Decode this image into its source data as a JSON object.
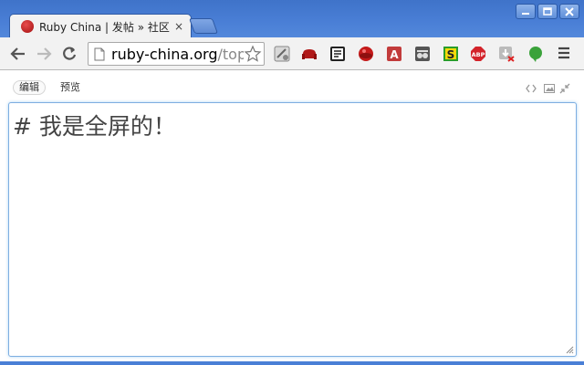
{
  "window": {
    "controls": [
      "minimize",
      "maximize",
      "close"
    ]
  },
  "tab": {
    "title": "Ruby China | 发帖 » 社区",
    "close_glyph": "×",
    "favicon": "ruby-china-favicon"
  },
  "toolbar": {
    "back_icon": "back-arrow-icon",
    "forward_icon": "forward-arrow-icon",
    "reload_icon": "reload-icon",
    "url_host": "ruby-china.org",
    "url_rest": "/top",
    "extensions": [
      "image-edit-extension-icon",
      "sofa-extension-icon",
      "note-extension-icon",
      "ruby-extension-icon",
      "a-extension-icon",
      "glasses-extension-icon",
      "s-extension-icon",
      "adblock-plus-extension-icon",
      "download-x-extension-icon",
      "evernote-extension-icon"
    ],
    "abp_text": "ABP",
    "a_text": "A",
    "s_text": "S"
  },
  "editor_bar": {
    "edit_label": "编辑",
    "preview_label": "预览"
  },
  "editor": {
    "content": "# 我是全屏的！"
  },
  "colors": {
    "frame_blue": "#4a7fd6",
    "focus_border": "#7eaee0",
    "ruby_red": "#c41a1a"
  }
}
